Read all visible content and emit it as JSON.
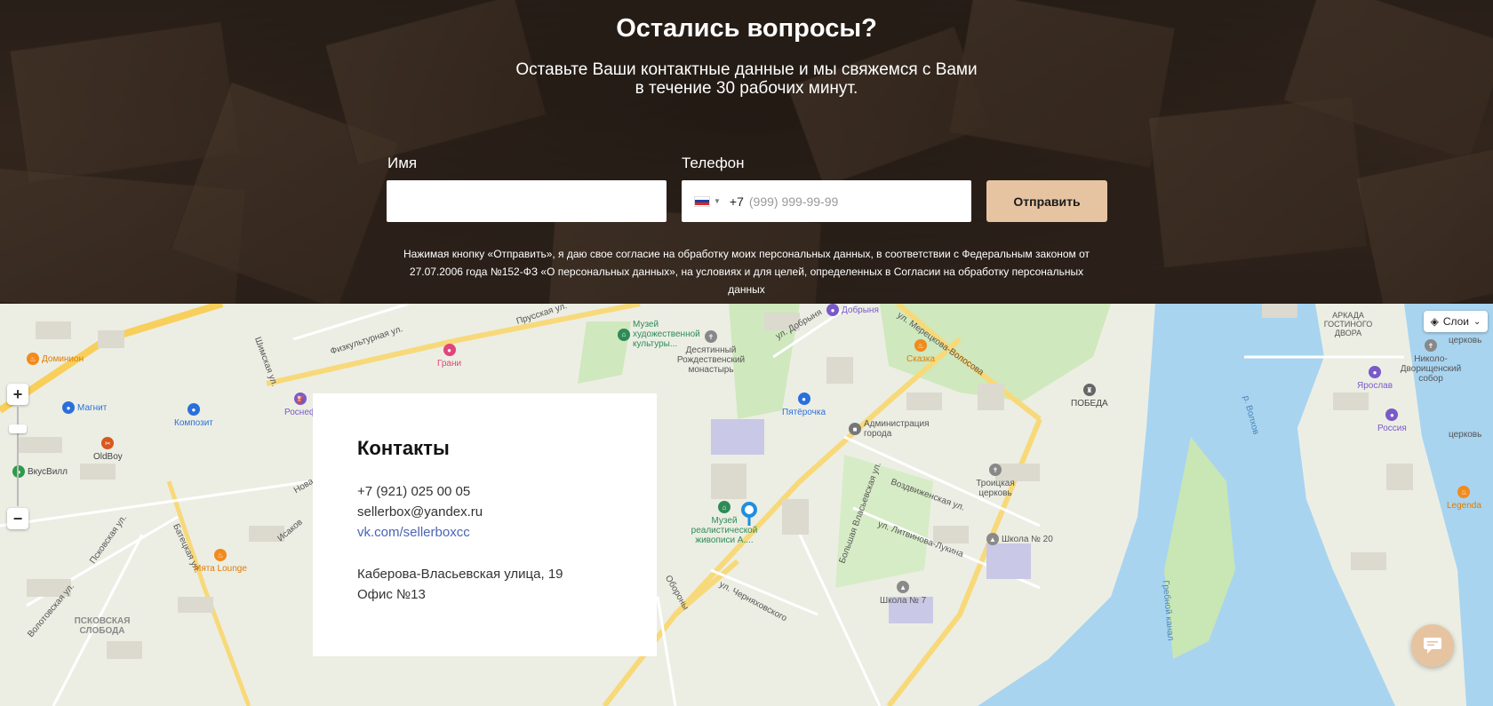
{
  "hero": {
    "title": "Остались вопросы?",
    "subtitle": "Оставьте Ваши контактные данные и мы свяжемся с Вами в течение 30 рабочих минут.",
    "name_label": "Имя",
    "name_value": "",
    "phone_label": "Телефон",
    "phone_prefix": "+7",
    "phone_placeholder": "(999) 999-99-99",
    "flag_icon": "russia-flag-icon",
    "submit_label": "Отправить",
    "consent_line1": "Нажимая кнопку «Отправить», я даю свое согласие на обработку моих персональных данных, в соответствии с Федеральным законом от",
    "consent_line2": "27.07.2006 года №152-ФЗ «О персональных данных», на условиях и для целей, определенных в Согласии на обработку персональных данных"
  },
  "map": {
    "layers_label": "Слои",
    "layers_icon": "layers-icon",
    "zoom_in": "+",
    "zoom_out": "−",
    "labels": {
      "prusskaya": "Прусская ул.",
      "fizkulturnaya": "Физкультурная ул.",
      "shimskaya": "Шимская ул.",
      "dobrynya_st": "ул. Добрыня",
      "meretskova": "ул. Мерецкова-Волосова",
      "vozdvizhenskaya": "Воздвиженская ул.",
      "litvinova": "ул. Литвинова-Лукина",
      "bolshaya_vlasievskaya": "Большая Власьевская ул.",
      "chernyakhovskogo": "ул. Черняховского",
      "oborony": "Обороны",
      "batetskaya": "Батецкая ул.",
      "volotovskaya": "Волотовская ул.",
      "pskovskaya": "Псковская ул.",
      "isakova": "Исаков",
      "nova": "Нова",
      "river_volkhov": "р. Волхов",
      "grebnoy_kanal": "Гребной канал",
      "pskovskaya_sloboda": "ПСКОВСКАЯ СЛОБОДА",
      "arkada": "АРКАДА ГОСТИНОГО ДВОРА"
    },
    "pois": {
      "museum_art": "Музей художественной культуры...",
      "dobrynya": "Добрыня",
      "desyatinny": "Десятинный Рождественский монастырь",
      "skazka": "Сказка",
      "pobeda": "ПОБЕДА",
      "pyaterochka": "Пятёрочка",
      "administration": "Администрация города",
      "troitskaya": "Троицкая церковь",
      "school20": "Школа № 20",
      "school7": "Школа № 7",
      "museum_real": "Музей реалистической живописи А....",
      "dominion": "Доминион",
      "magnit": "Магнит",
      "kompozit": "Композит",
      "oldboy": "OldBoy",
      "vkusvill": "ВкусВилл",
      "myata": "Мята Lounge",
      "grani": "Грани",
      "rosneft": "Роснеф",
      "yaroslav": "Ярослав",
      "rossiya": "Россия",
      "legenda": "Legenda",
      "nikolo": "Николо-Дворищенский собор",
      "tserkov": "церковь",
      "tserkov2": "церковь"
    }
  },
  "contacts": {
    "title": "Контакты",
    "phone": "+7 (921) 025 00 05",
    "email": "sellerbox@yandex.ru",
    "vk": "vk.com/sellerboxcc",
    "address": "Каберова-Власьевская улица, 19",
    "office": "Офис №13"
  },
  "chat": {
    "icon": "chat-bubble-icon"
  },
  "colors": {
    "accent": "#e6c4a2",
    "link": "#4a64b5",
    "water": "#a8d4f0",
    "park": "#c9e6b5",
    "road_major": "#f8cf5a",
    "marker": "#1f8fe0"
  }
}
